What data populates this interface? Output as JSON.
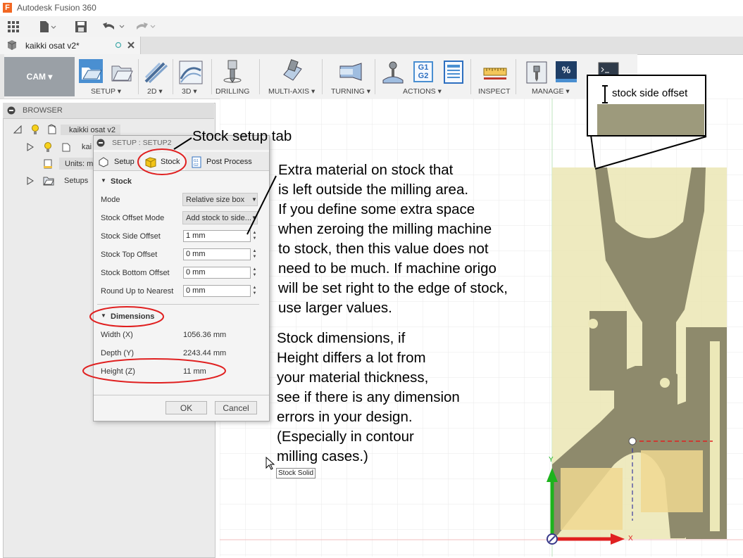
{
  "app": {
    "title": "Autodesk Fusion 360",
    "logo_letter": "F"
  },
  "document": {
    "tab_name": "kaikki osat v2*"
  },
  "ribbon": {
    "workspace": "CAM ▾",
    "groups": [
      {
        "label": "SETUP ▾"
      },
      {
        "label": "2D ▾"
      },
      {
        "label": "3D ▾"
      },
      {
        "label": "DRILLING"
      },
      {
        "label": "MULTI-AXIS ▾"
      },
      {
        "label": "TURNING ▾"
      },
      {
        "label": "ACTIONS ▾"
      },
      {
        "label": "INSPECT"
      },
      {
        "label": "MANAGE ▾"
      }
    ],
    "actions_g1g2_icon": "G1\nG2",
    "percent_icon": "%"
  },
  "browser": {
    "title": "BROWSER",
    "items": [
      {
        "label": "kaikki osat v2"
      },
      {
        "label": "kai"
      },
      {
        "label": "Units: mr"
      },
      {
        "label": "Setups"
      }
    ]
  },
  "dialog": {
    "title": "SETUP : SETUP2",
    "tabs": [
      "Setup",
      "Stock",
      "Post Process"
    ],
    "stock_section": "Stock",
    "rows": [
      {
        "label": "Mode",
        "value": "Relative size box"
      },
      {
        "label": "Stock Offset Mode",
        "value": "Add stock to side..."
      },
      {
        "label": "Stock Side Offset",
        "value": "1 mm"
      },
      {
        "label": "Stock Top Offset",
        "value": "0 mm"
      },
      {
        "label": "Stock Bottom Offset",
        "value": "0 mm"
      },
      {
        "label": "Round Up to Nearest",
        "value": "0 mm"
      }
    ],
    "dimensions_section": "Dimensions",
    "dimensions": [
      {
        "label": "Width (X)",
        "value": "1056.36 mm"
      },
      {
        "label": "Depth (Y)",
        "value": "2243.44 mm"
      },
      {
        "label": "Height (Z)",
        "value": "11 mm"
      }
    ],
    "ok": "OK",
    "cancel": "Cancel"
  },
  "tooltip": "Stock Solid",
  "annotations": {
    "tab_note": "Stock setup tab",
    "offset_note": [
      "Extra material on stock that",
      "is left outside the milling area.",
      "If you define some extra space",
      "when zeroing the milling machine",
      "to stock, then this value does not",
      "need to be much. If machine origo",
      "will be set right to the edge of stock,",
      "use larger values."
    ],
    "dimension_note": [
      "Stock dimensions, if",
      "Height differs a lot from",
      "your material thickness,",
      "see if there is any dimension",
      "errors in your design.",
      "(Especially in contour",
      "milling cases.)"
    ],
    "callout_label": "stock side offset"
  },
  "viewport": {
    "axis_x": "X",
    "axis_y": "Y"
  },
  "colors": {
    "accent_red": "#e02020",
    "stock_fill": "#ece8b8",
    "part_fill": "#8e8a6c"
  }
}
